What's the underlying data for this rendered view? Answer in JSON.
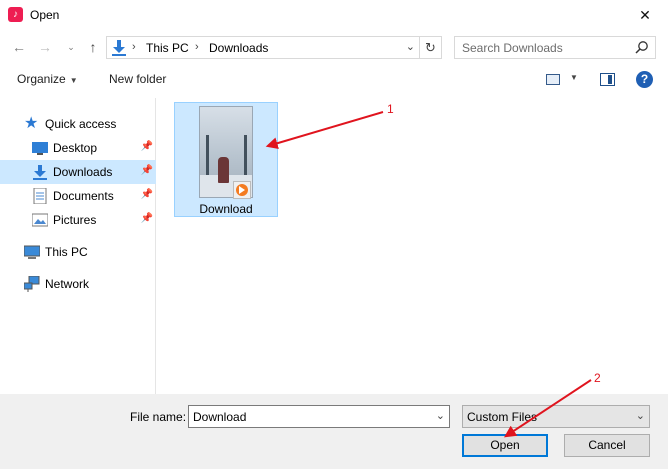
{
  "window": {
    "title": "Open",
    "close_glyph": "✕",
    "app_icon": "tiktok-icon"
  },
  "address": {
    "crumbs": [
      "This PC",
      "Downloads"
    ]
  },
  "search": {
    "placeholder": "Search Downloads"
  },
  "toolbar": {
    "organize_label": "Organize",
    "new_folder_label": "New folder",
    "help_glyph": "?"
  },
  "nav": {
    "quick_access": "Quick access",
    "items": [
      {
        "label": "Desktop",
        "icon": "desktop-icon",
        "pinned": true
      },
      {
        "label": "Downloads",
        "icon": "downloads-icon",
        "pinned": true,
        "selected": true
      },
      {
        "label": "Documents",
        "icon": "documents-icon",
        "pinned": true
      },
      {
        "label": "Pictures",
        "icon": "pictures-icon",
        "pinned": true
      }
    ],
    "this_pc": "This PC",
    "network": "Network"
  },
  "files": [
    {
      "name": "Download",
      "type": "video",
      "selected": true
    }
  ],
  "bottom": {
    "file_name_label": "File name:",
    "file_name_value": "Download",
    "file_type_value": "Custom Files",
    "open_label": "Open",
    "cancel_label": "Cancel"
  },
  "annotations": {
    "color": "#e0141e",
    "labels": [
      "1",
      "2"
    ]
  },
  "colors": {
    "selection": "#cce8ff",
    "selection_border": "#99d1ff",
    "accent": "#0078d7"
  }
}
